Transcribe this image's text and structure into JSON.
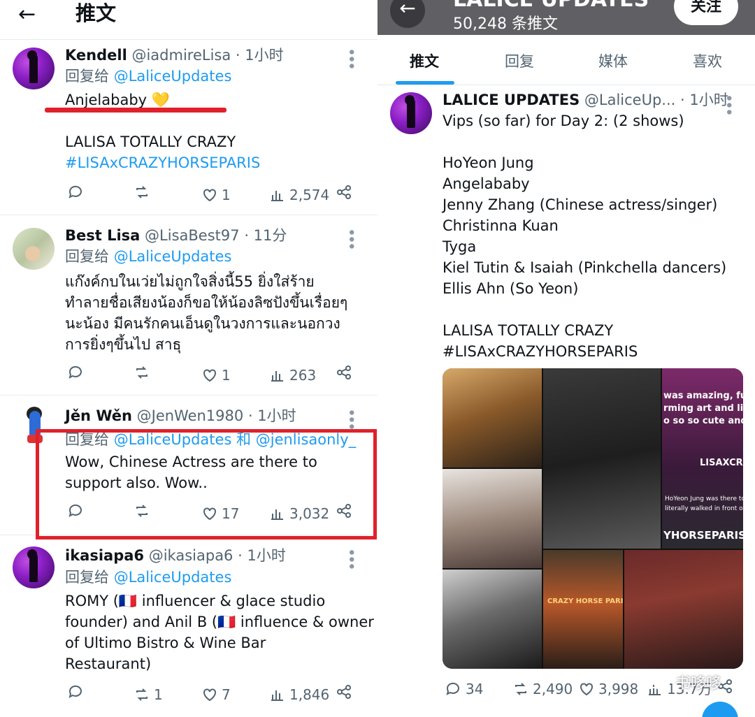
{
  "left": {
    "header": {
      "back_icon": "arrow-left-icon",
      "title": "推文"
    },
    "replies": [
      {
        "name": "Kendell",
        "handle": "@iadmireLisa",
        "time": "· 1小时",
        "reply_prefix": "回复给",
        "reply_to": "@LaliceUpdates",
        "body": [
          "Anjelababy 💛",
          "",
          "LALISA TOTALLY CRAZY"
        ],
        "hashtag": "#LISAxCRAZYHORSEPARIS",
        "retweets": "",
        "likes": "1",
        "views": "2,574"
      },
      {
        "name": "Best Lisa",
        "handle": "@LisaBest97",
        "time": "· 11分",
        "reply_prefix": "回复给",
        "reply_to": "@LaliceUpdates",
        "body": [
          "แก๊งค์กบในเว่ยไม่ถูกใจสิ่งนี้55 ยิ่งใส่ร้าย",
          "ทำลายชื่อเสียงน้องก็ขอให้น้องลิซปังขึ้นเรื่อยๆ",
          "นะน้อง มีคนรักคนเอ็นดูในวงการและนอกวง",
          "การยิ่งๆขึ้นไป สาธุ"
        ],
        "retweets": "",
        "likes": "1",
        "views": "263"
      },
      {
        "name": "Jěn Wěn",
        "handle": "@JenWen1980",
        "time": "· 1小时",
        "reply_prefix": "回复给",
        "reply_to": "@LaliceUpdates 和 @jenlisaonly_",
        "body": [
          "Wow, Chinese Actress are there to",
          "support also. Wow.."
        ],
        "retweets": "",
        "likes": "17",
        "views": "3,032"
      },
      {
        "name": "ikasiapa6",
        "handle": "@ikasiapa6",
        "time": "· 1小时",
        "reply_prefix": "回复给",
        "reply_to": "@LaliceUpdates",
        "body": [
          "ROMY (🇫🇷 influencer & glace studio",
          "founder) and Anil B (🇫🇷 influence & owner",
          "of Ultimo Bistro & Wine Bar",
          "Restaurant)"
        ],
        "retweets": "1",
        "likes": "7",
        "views": "1,846"
      }
    ]
  },
  "right": {
    "header": {
      "account_title": "LALICE UPDATES",
      "tweet_count": "50,248 条推文",
      "follow_label": "关注"
    },
    "tabs": [
      "推文",
      "回复",
      "媒体",
      "喜欢"
    ],
    "tweet": {
      "name": "LALICE UPDATES",
      "handle": "@LaliceUp...",
      "time": "· 1小时",
      "lines": [
        "Vips (so far) for Day 2: (2 shows)",
        "",
        "HoYeon Jung",
        "Angelababy",
        "Jenny Zhang (Chinese actress/singer)",
        "Christinna Kuan",
        "Tyga",
        "Kiel Tutin & Isaiah (Pinkchella dancers)",
        "Ellis Ahn (So Yeon)",
        "",
        "LALISA TOTALLY CRAZY"
      ],
      "hashtag": "#LISAxCRAZYHORSEPARIS",
      "media_texts": [
        "was amazing, fun,",
        "rming art and lisa",
        "o so so cute and s",
        "LISAXCRAZ",
        "HoYeon Jung was there too",
        "literally walked in front of",
        "YHORSEPARIS",
        "CRAZY HORSE PARIS"
      ],
      "replies": "34",
      "retweets": "2,490",
      "likes": "3,998",
      "views": "13.7万"
    }
  },
  "watermark": "书哆哆",
  "colors": {
    "link": "#1d9bf0",
    "highlight": "#e0212b",
    "muted": "#536471"
  }
}
